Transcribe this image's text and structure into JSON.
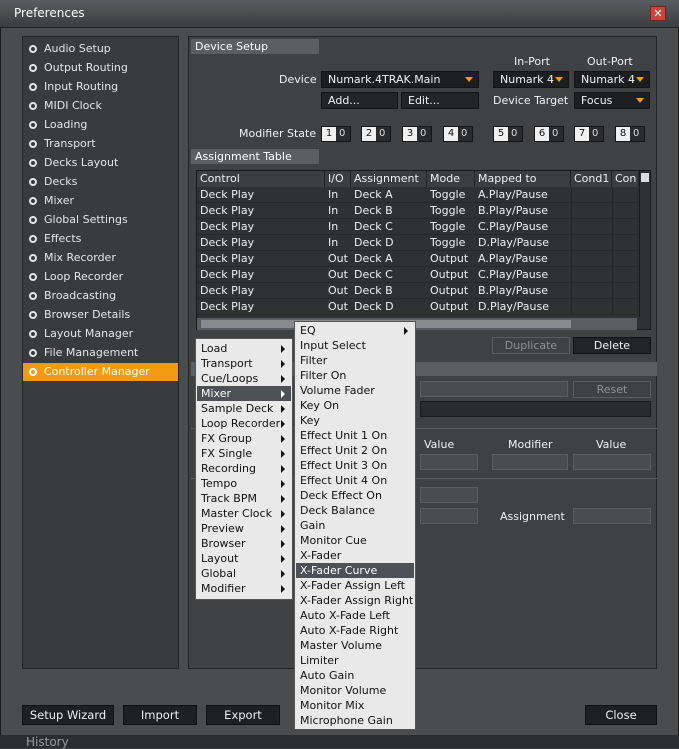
{
  "window": {
    "title": "Preferences",
    "close_glyph": "✕"
  },
  "sidebar": {
    "items": [
      "Audio Setup",
      "Output Routing",
      "Input Routing",
      "MIDI Clock",
      "Loading",
      "Transport",
      "Decks Layout",
      "Decks",
      "Mixer",
      "Global Settings",
      "Effects",
      "Mix Recorder",
      "Loop Recorder",
      "Broadcasting",
      "Browser Details",
      "Layout Manager",
      "File Management",
      "Controller Manager"
    ],
    "active": "Controller Manager"
  },
  "device_setup": {
    "header": "Device Setup",
    "device_label": "Device",
    "device_value": "Numark.4TRAK.Main",
    "in_port_label": "In-Port",
    "in_port_value": "Numark 4",
    "out_port_label": "Out-Port",
    "out_port_value": "Numark 4",
    "add_label": "Add...",
    "edit_label": "Edit...",
    "device_target_label": "Device Target",
    "device_target_value": "Focus",
    "modifier_state_label": "Modifier State",
    "modifiers": [
      {
        "n": "1",
        "v": "0"
      },
      {
        "n": "2",
        "v": "0"
      },
      {
        "n": "3",
        "v": "0"
      },
      {
        "n": "4",
        "v": "0"
      },
      {
        "n": "5",
        "v": "0"
      },
      {
        "n": "6",
        "v": "0"
      },
      {
        "n": "7",
        "v": "0"
      },
      {
        "n": "8",
        "v": "0"
      }
    ]
  },
  "assignment_table": {
    "header": "Assignment Table",
    "columns": [
      "Control",
      "I/O",
      "Assignment",
      "Mode",
      "Mapped to",
      "Cond1",
      "Con"
    ],
    "rows": [
      [
        "Deck Play",
        "In",
        "Deck A",
        "Toggle",
        "A.Play/Pause"
      ],
      [
        "Deck Play",
        "In",
        "Deck B",
        "Toggle",
        "B.Play/Pause"
      ],
      [
        "Deck Play",
        "In",
        "Deck C",
        "Toggle",
        "C.Play/Pause"
      ],
      [
        "Deck Play",
        "In",
        "Deck D",
        "Toggle",
        "D.Play/Pause"
      ],
      [
        "Deck Play",
        "Out",
        "Deck A",
        "Output",
        "A.Play/Pause"
      ],
      [
        "Deck Play",
        "Out",
        "Deck C",
        "Output",
        "C.Play/Pause"
      ],
      [
        "Deck Play",
        "Out",
        "Deck B",
        "Output",
        "B.Play/Pause"
      ],
      [
        "Deck Play",
        "Out",
        "Deck D",
        "Output",
        "D.Play/Pause"
      ]
    ],
    "duplicate_label": "Duplicate",
    "delete_label": "Delete"
  },
  "lower_panel": {
    "reset_label": "Reset",
    "value_label_1": "Value",
    "modifier_label": "Modifier",
    "value_label_2": "Value",
    "assignment_label": "Assignment"
  },
  "context_menu": {
    "items": [
      {
        "label": "Load",
        "sub": true
      },
      {
        "label": "Transport",
        "sub": true
      },
      {
        "label": "Cue/Loops",
        "sub": true
      },
      {
        "label": "Mixer",
        "sub": true,
        "selected": true
      },
      {
        "label": "Sample Deck",
        "sub": true
      },
      {
        "label": "Loop Recorder",
        "sub": true
      },
      {
        "label": "FX Group",
        "sub": true
      },
      {
        "label": "FX Single",
        "sub": true
      },
      {
        "label": "Recording",
        "sub": true
      },
      {
        "label": "Tempo",
        "sub": true
      },
      {
        "label": "Track BPM",
        "sub": true
      },
      {
        "label": "Master Clock",
        "sub": true
      },
      {
        "label": "Preview",
        "sub": true
      },
      {
        "label": "Browser",
        "sub": true
      },
      {
        "label": "Layout",
        "sub": true
      },
      {
        "label": "Global",
        "sub": true
      },
      {
        "label": "Modifier",
        "sub": true
      }
    ]
  },
  "mixer_submenu": {
    "items": [
      {
        "label": "EQ",
        "sub": true
      },
      {
        "label": "Input Select"
      },
      {
        "label": "Filter"
      },
      {
        "label": "Filter On"
      },
      {
        "label": "Volume Fader"
      },
      {
        "label": "Key On"
      },
      {
        "label": "Key"
      },
      {
        "label": "Effect Unit 1 On"
      },
      {
        "label": "Effect Unit 2 On"
      },
      {
        "label": "Effect Unit 3 On"
      },
      {
        "label": "Effect Unit 4 On"
      },
      {
        "label": "Deck Effect On"
      },
      {
        "label": "Deck Balance"
      },
      {
        "label": "Gain"
      },
      {
        "label": "Monitor Cue"
      },
      {
        "label": "X-Fader"
      },
      {
        "label": "X-Fader Curve",
        "selected": true
      },
      {
        "label": "X-Fader Assign Left"
      },
      {
        "label": "X-Fader Assign Right"
      },
      {
        "label": "Auto X-Fade Left"
      },
      {
        "label": "Auto X-Fade Right"
      },
      {
        "label": "Master Volume"
      },
      {
        "label": "Limiter"
      },
      {
        "label": "Auto Gain"
      },
      {
        "label": "Monitor Volume"
      },
      {
        "label": "Monitor Mix"
      },
      {
        "label": "Microphone Gain"
      }
    ]
  },
  "footer": {
    "setup_wizard_label": "Setup Wizard",
    "import_label": "Import",
    "export_label": "Export",
    "close_label": "Close"
  },
  "background": {
    "history_label": "History"
  },
  "colors": {
    "accent": "#f19a12",
    "menu_selected": "#4d5055",
    "menu_bg": "#e9e9e9"
  }
}
